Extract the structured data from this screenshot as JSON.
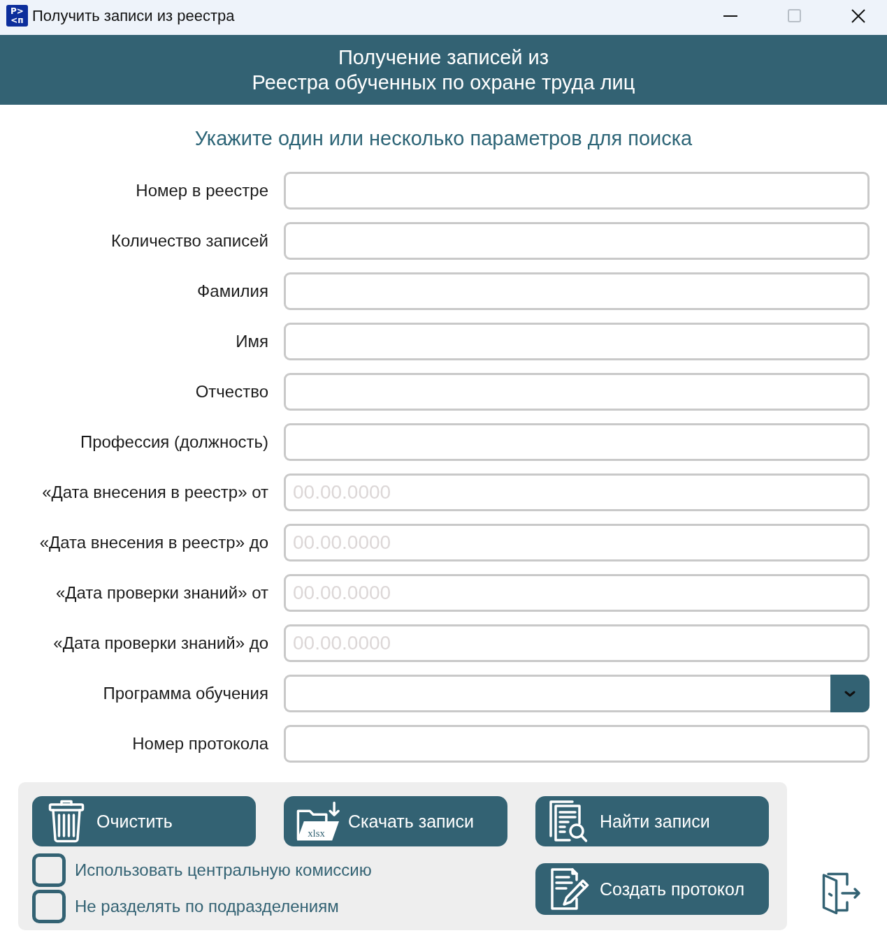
{
  "window": {
    "logo_lines": [
      "Р>",
      "<п"
    ],
    "title": "Получить записи из реестра",
    "controls": [
      {
        "kind": "minimize",
        "disabled": false
      },
      {
        "kind": "maximize",
        "disabled": true
      },
      {
        "kind": "close",
        "disabled": false
      }
    ]
  },
  "header": {
    "title_lines": [
      "Получение записей из",
      "Реестра обученных по охране труда лиц"
    ]
  },
  "instruction": "Укажите один или несколько параметров для поиска",
  "fields": [
    {
      "label": "Номер в реестре",
      "kind": "text"
    },
    {
      "label": "Количество записей",
      "kind": "text"
    },
    {
      "label": "Фамилия",
      "kind": "text"
    },
    {
      "label": "Имя",
      "kind": "text"
    },
    {
      "label": "Отчество",
      "kind": "text"
    },
    {
      "label": "Профессия (должность)",
      "kind": "text"
    },
    {
      "label": "«Дата внесения в реестр» от",
      "kind": "date",
      "placeholder": "00.00.0000"
    },
    {
      "label": "«Дата внесения в реестр» до",
      "kind": "date",
      "placeholder": "00.00.0000"
    },
    {
      "label": "«Дата проверки знаний» от",
      "kind": "date",
      "placeholder": "00.00.0000"
    },
    {
      "label": "«Дата проверки знаний» до",
      "kind": "date",
      "placeholder": "00.00.0000"
    },
    {
      "label": "Программа обучения",
      "kind": "dropdown"
    },
    {
      "label": "Номер протокола",
      "kind": "text"
    }
  ],
  "actions": [
    {
      "kind": "clear",
      "label": "Очистить"
    },
    {
      "kind": "download",
      "label": "Скачать записи",
      "icon_text": "xlsx"
    },
    {
      "kind": "find",
      "label": "Найти записи"
    },
    {
      "kind": "protocol",
      "label": "Создать протокол"
    }
  ],
  "options": [
    {
      "label": "Использовать центральную комиссию",
      "checked": false
    },
    {
      "label": "Не разделять по подразделениям",
      "checked": false
    }
  ]
}
